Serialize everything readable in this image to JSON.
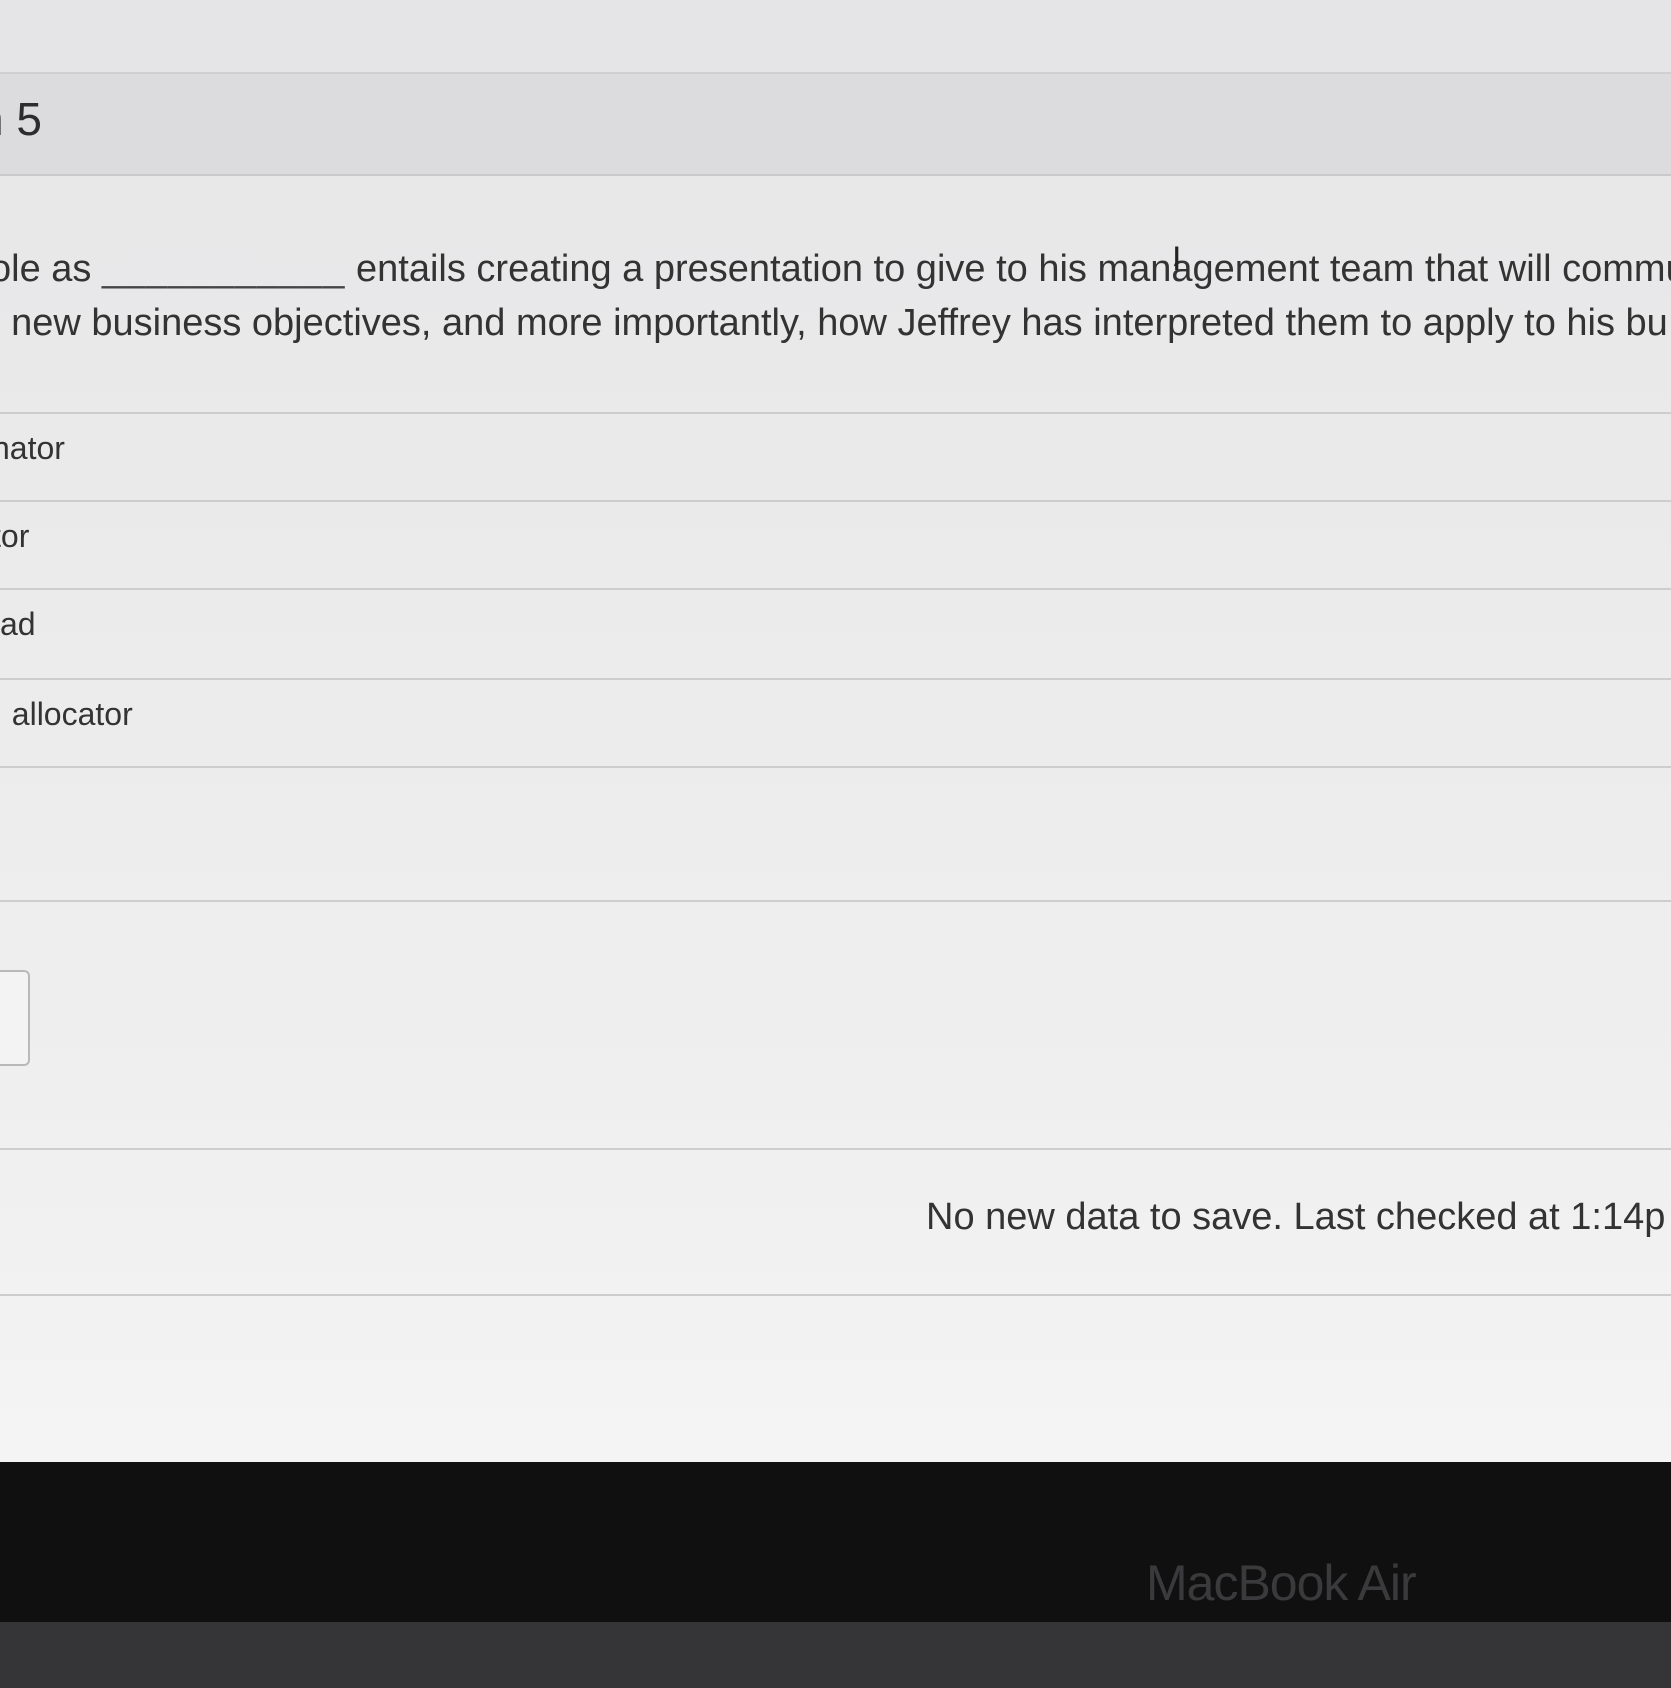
{
  "question": {
    "title": "n 5",
    "line1_prefix": "ole as",
    "blank": "___________",
    "line1_suffix": "entails creating a presentation to give to his management team that will communic",
    "line2": ": new business objectives, and more importantly, how Jeffrey has interpreted them to apply to his bu"
  },
  "options": [
    {
      "label": "nator"
    },
    {
      "label": "tor"
    },
    {
      "label": "ad"
    },
    {
      "label": ": allocator"
    }
  ],
  "status": {
    "save_message": "No new data to save. Last checked at 1:14p"
  },
  "device": {
    "label": "MacBook Air"
  }
}
